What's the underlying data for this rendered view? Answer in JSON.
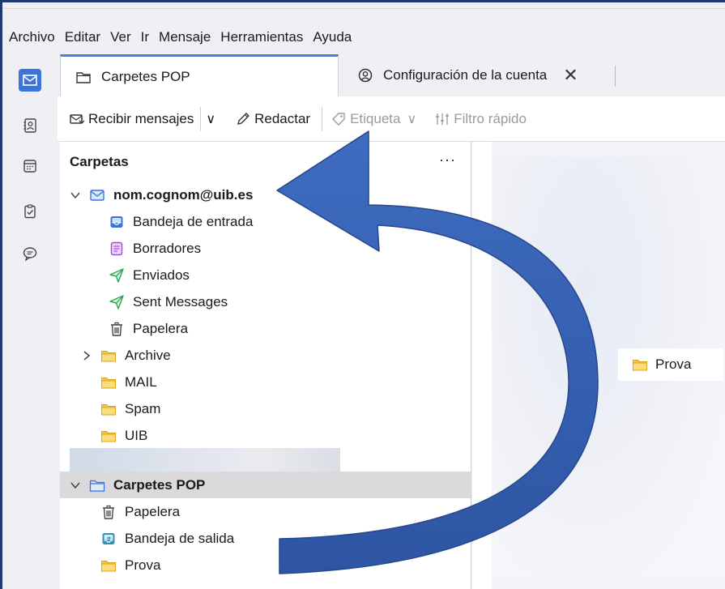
{
  "menubar": {
    "items": [
      {
        "label": "Archivo"
      },
      {
        "label": "Editar"
      },
      {
        "label": "Ver"
      },
      {
        "label": "Ir"
      },
      {
        "label": "Mensaje"
      },
      {
        "label": "Herramientas"
      },
      {
        "label": "Ayuda"
      }
    ]
  },
  "tabs": [
    {
      "label": "Carpetes POP",
      "icon": "folder-icon",
      "active": true
    },
    {
      "label": "Configuración de la cuenta",
      "icon": "account-settings-icon",
      "close": "✕",
      "active": false
    }
  ],
  "toolbar": {
    "get_messages": "Recibir mensajes",
    "dropdown": "∨",
    "write": "Redactar",
    "tag": "Etiqueta",
    "tag_dropdown": "∨",
    "quick_filter": "Filtro rápido"
  },
  "folder_pane": {
    "title": "Carpetas",
    "more": "···",
    "account": "nom.cognom@uib.es",
    "account_folders": [
      {
        "label": "Bandeja de entrada",
        "icon": "inbox-icon"
      },
      {
        "label": "Borradores",
        "icon": "drafts-icon"
      },
      {
        "label": "Enviados",
        "icon": "sent-icon"
      },
      {
        "label": "Sent Messages",
        "icon": "sent-icon"
      },
      {
        "label": "Papelera",
        "icon": "trash-icon"
      },
      {
        "label": "Archive",
        "icon": "folder-icon"
      },
      {
        "label": "MAIL",
        "icon": "folder-icon"
      },
      {
        "label": "Spam",
        "icon": "folder-icon"
      },
      {
        "label": "UIB",
        "icon": "folder-icon"
      }
    ],
    "local_account": "Carpetes POP",
    "local_folders": [
      {
        "label": "Papelera",
        "icon": "trash-icon"
      },
      {
        "label": "Bandeja de salida",
        "icon": "outbox-icon"
      },
      {
        "label": "Prova",
        "icon": "folder-icon"
      }
    ]
  },
  "message_pane": {
    "dragged_folder": "Prova"
  },
  "colors": {
    "accent": "#3b74d8",
    "folder_yellow": "#f5c84a",
    "arrow_blue": "#3a64b2",
    "sent_green": "#2faa5a",
    "drafts_purple": "#a44bd6"
  }
}
